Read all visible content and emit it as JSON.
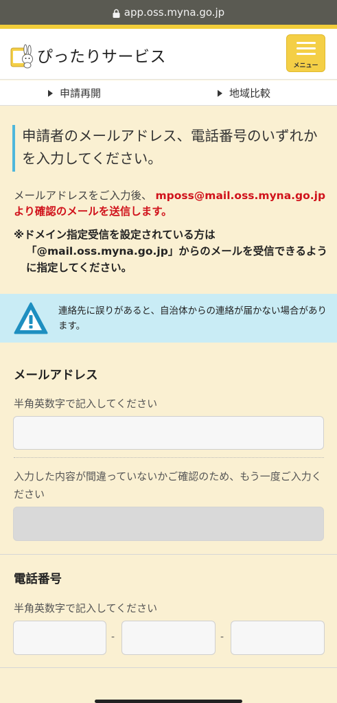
{
  "browser": {
    "url": "app.oss.myna.go.jp"
  },
  "header": {
    "site_title": "ぴったりサービス",
    "menu_label": "メニュー",
    "brand_color": "#f4cf46"
  },
  "subnav": {
    "items": [
      {
        "label": "申請再開"
      },
      {
        "label": "地域比較"
      }
    ]
  },
  "main": {
    "heading": "申請者のメールアドレス、電話番号のいずれかを入力してください。",
    "desc_prefix": "メールアドレスをご入力後、",
    "desc_red": "mposs@mail.oss.myna.go.jpより確認のメールを送信します。",
    "note": "※ドメイン指定受信を設定されている方は「@mail.oss.myna.go.jp」からのメールを受信できるように指定してください。",
    "warning": {
      "text": "連絡先に誤りがあると、自治体からの連絡が届かない場合があります。",
      "icon": "warning-icon",
      "color": "#c9ecf5"
    }
  },
  "email_section": {
    "title": "メールアドレス",
    "hint": "半角英数字で記入してください",
    "value": "",
    "confirm_hint": "入力した内容が間違っていないかご確認のため、もう一度ご入力ください",
    "confirm_value": ""
  },
  "phone_section": {
    "title": "電話番号",
    "hint": "半角英数字で記入してください",
    "separator": "-",
    "parts": [
      "",
      "",
      ""
    ]
  }
}
